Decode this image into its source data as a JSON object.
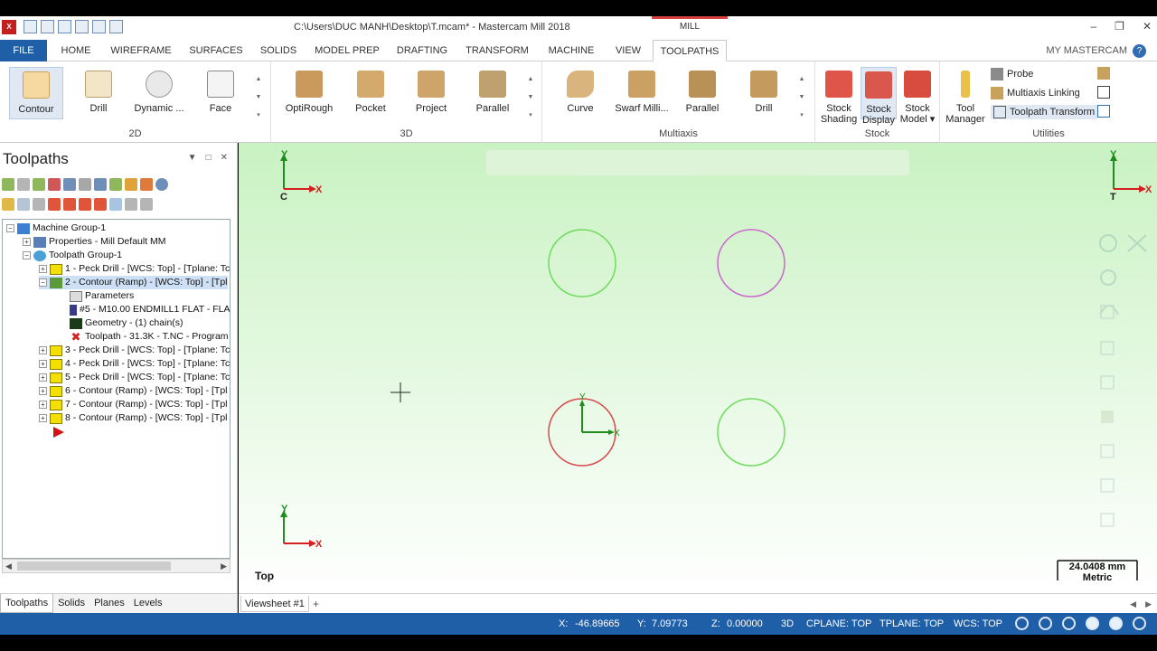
{
  "window": {
    "title": "C:\\Users\\DUC MANH\\Desktop\\T.mcam* - Mastercam Mill 2018",
    "contextual_tab": "MILL",
    "app_icon_text": "X"
  },
  "tabs": [
    "FILE",
    "HOME",
    "WIREFRAME",
    "SURFACES",
    "SOLIDS",
    "MODEL PREP",
    "DRAFTING",
    "TRANSFORM",
    "MACHINE",
    "VIEW",
    "TOOLPATHS"
  ],
  "active_tab": "TOOLPATHS",
  "my_mastercam": "MY MASTERCAM",
  "ribbon": {
    "group_2d": {
      "label": "2D",
      "buttons": [
        "Contour",
        "Drill",
        "Dynamic ...",
        "Face"
      ]
    },
    "group_3d": {
      "label": "3D",
      "buttons": [
        "OptiRough",
        "Pocket",
        "Project",
        "Parallel"
      ]
    },
    "group_multiaxis": {
      "label": "Multiaxis",
      "buttons": [
        "Curve",
        "Swarf Milli...",
        "Parallel",
        "Drill"
      ]
    },
    "group_stock": {
      "label": "Stock",
      "buttons": [
        [
          "Stock",
          "Shading"
        ],
        [
          "Stock",
          "Display"
        ],
        [
          "Stock",
          "Model ▾"
        ]
      ]
    },
    "group_utilities": {
      "label": "Utilities",
      "tool_manager": [
        "Tool",
        "Manager"
      ],
      "items": [
        "Probe",
        "Multiaxis Linking",
        "Toolpath Transform"
      ]
    }
  },
  "panel": {
    "title": "Toolpaths",
    "tree": [
      "Machine Group-1",
      "Properties - Mill Default MM",
      "Toolpath Group-1",
      "1 - Peck Drill - [WCS: Top] - [Tplane: Tc",
      "2 - Contour (Ramp) - [WCS: Top] - [Tpl",
      "Parameters",
      "#5 - M10.00 ENDMILL1 FLAT - FLA",
      "Geometry - (1) chain(s)",
      "Toolpath - 31.3K - T.NC - Program",
      "3 - Peck Drill - [WCS: Top] - [Tplane: Tc",
      "4 - Peck Drill - [WCS: Top] - [Tplane: Tc",
      "5 - Peck Drill - [WCS: Top] - [Tplane: Tc",
      "6 - Contour (Ramp) - [WCS: Top] - [Tpl",
      "7 - Contour (Ramp) - [WCS: Top] - [Tpl",
      "8 - Contour (Ramp) - [WCS: Top] - [Tpl"
    ],
    "bottom_tabs": [
      "Toolpaths",
      "Solids",
      "Planes",
      "Levels"
    ]
  },
  "viewport": {
    "view_name": "Top",
    "scale_value": "24.0408 mm",
    "scale_unit": "Metric",
    "axis_labels": {
      "x": "X",
      "y": "Y",
      "c": "C",
      "t": "T"
    },
    "circle_colors": {
      "green": "#6fdc5e",
      "magenta": "#cc66cc",
      "red": "#d84a4a",
      "axis": "#1e8f1e",
      "axis_x": "#d42020"
    }
  },
  "viewsheet": {
    "tab": "Viewsheet #1",
    "add": "+"
  },
  "status": {
    "x_label": "X:",
    "x": "-46.89665",
    "y_label": "Y:",
    "y": "7.09773",
    "z_label": "Z:",
    "z": "0.00000",
    "mode": "3D",
    "cplane": "CPLANE: TOP",
    "tplane": "TPLANE: TOP",
    "wcs": "WCS: TOP"
  }
}
